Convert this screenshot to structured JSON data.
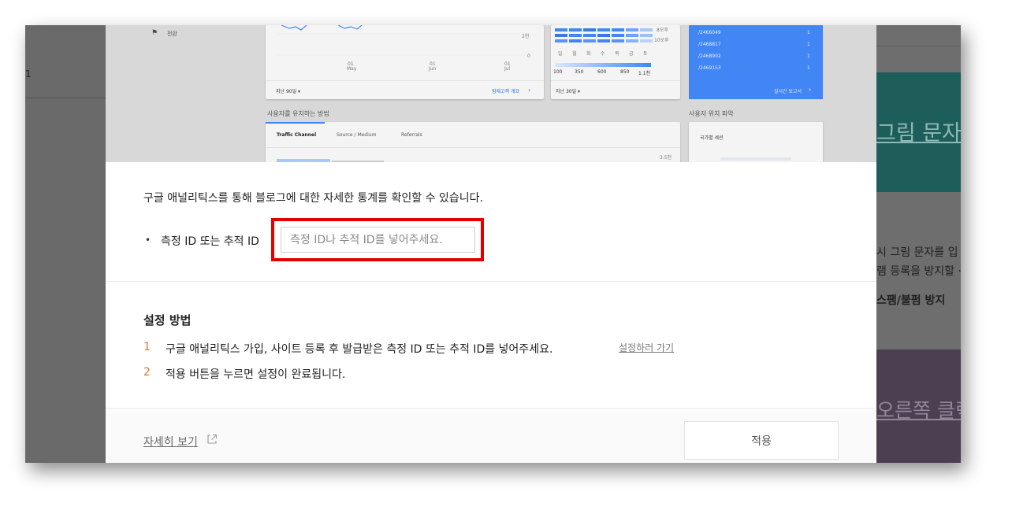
{
  "background": {
    "left_marker": "1",
    "right_teal_text": "그림 문자",
    "right_text_line1": "시 그림 문자를 입",
    "right_text_line2": "램 등록을 방지할 ·",
    "right_text_line3": "스팸/불펌 방지",
    "right_purple_text": "오른쪽 클릭"
  },
  "dashboard": {
    "flag_label": "전환",
    "line_chart": {
      "y_ticks": [
        "2천",
        "0"
      ],
      "x_ticks": [
        {
          "day": "01",
          "month": "May"
        },
        {
          "day": "01",
          "month": "Jun"
        },
        {
          "day": "01",
          "month": "Jul"
        }
      ],
      "footer_range": "지난 90일 ▾",
      "footer_link": "잠재고객 개요"
    },
    "heatmap": {
      "row_labels": [
        "8오후",
        "10오후"
      ],
      "day_labels": [
        "일",
        "월",
        "화",
        "수",
        "목",
        "금",
        "토"
      ],
      "legend_ticks": [
        "100",
        "350",
        "600",
        "850",
        "1.1천"
      ],
      "footer_range": "지난 30일 ▾"
    },
    "realtime": {
      "rows": [
        {
          "path": "/2466049",
          "count": "1"
        },
        {
          "path": "/2468817",
          "count": "1"
        },
        {
          "path": "/2468902",
          "count": "1"
        },
        {
          "path": "/2469153",
          "count": "1"
        }
      ],
      "link": "실시간 보고서"
    },
    "acquisition": {
      "title": "사용자를 유치하는 방법",
      "tabs": [
        "Traffic Channel",
        "Source / Medium",
        "Referrals"
      ],
      "tick": "3.5천"
    },
    "location": {
      "title": "사용자 위치 파악",
      "card_label": "국가별 세션"
    }
  },
  "modal": {
    "intro": "구글 애널리틱스를 통해 블로그에 대한 자세한 통계를 확인할 수 있습니다.",
    "bullet": "•",
    "field_label": "측정 ID 또는 추적 ID",
    "field_value": "",
    "field_placeholder": "측정 ID나 추적 ID를 넣어주세요.",
    "howto_title": "설정 방법",
    "steps": [
      {
        "num": "1",
        "text": "구글 애널리틱스 가입, 사이트 등록 후 발급받은 측정 ID 또는 추적 ID를 넣어주세요."
      },
      {
        "num": "2",
        "text": "적용 버튼을 누르면 설정이 완료됩니다."
      }
    ],
    "setup_link": "설정하러 가기",
    "more_link": "자세히 보기",
    "apply_button": "적용"
  },
  "colors": {
    "highlight_border": "#e00000",
    "step_number": "#d9772b",
    "analytics_blue": "#4285f4"
  }
}
